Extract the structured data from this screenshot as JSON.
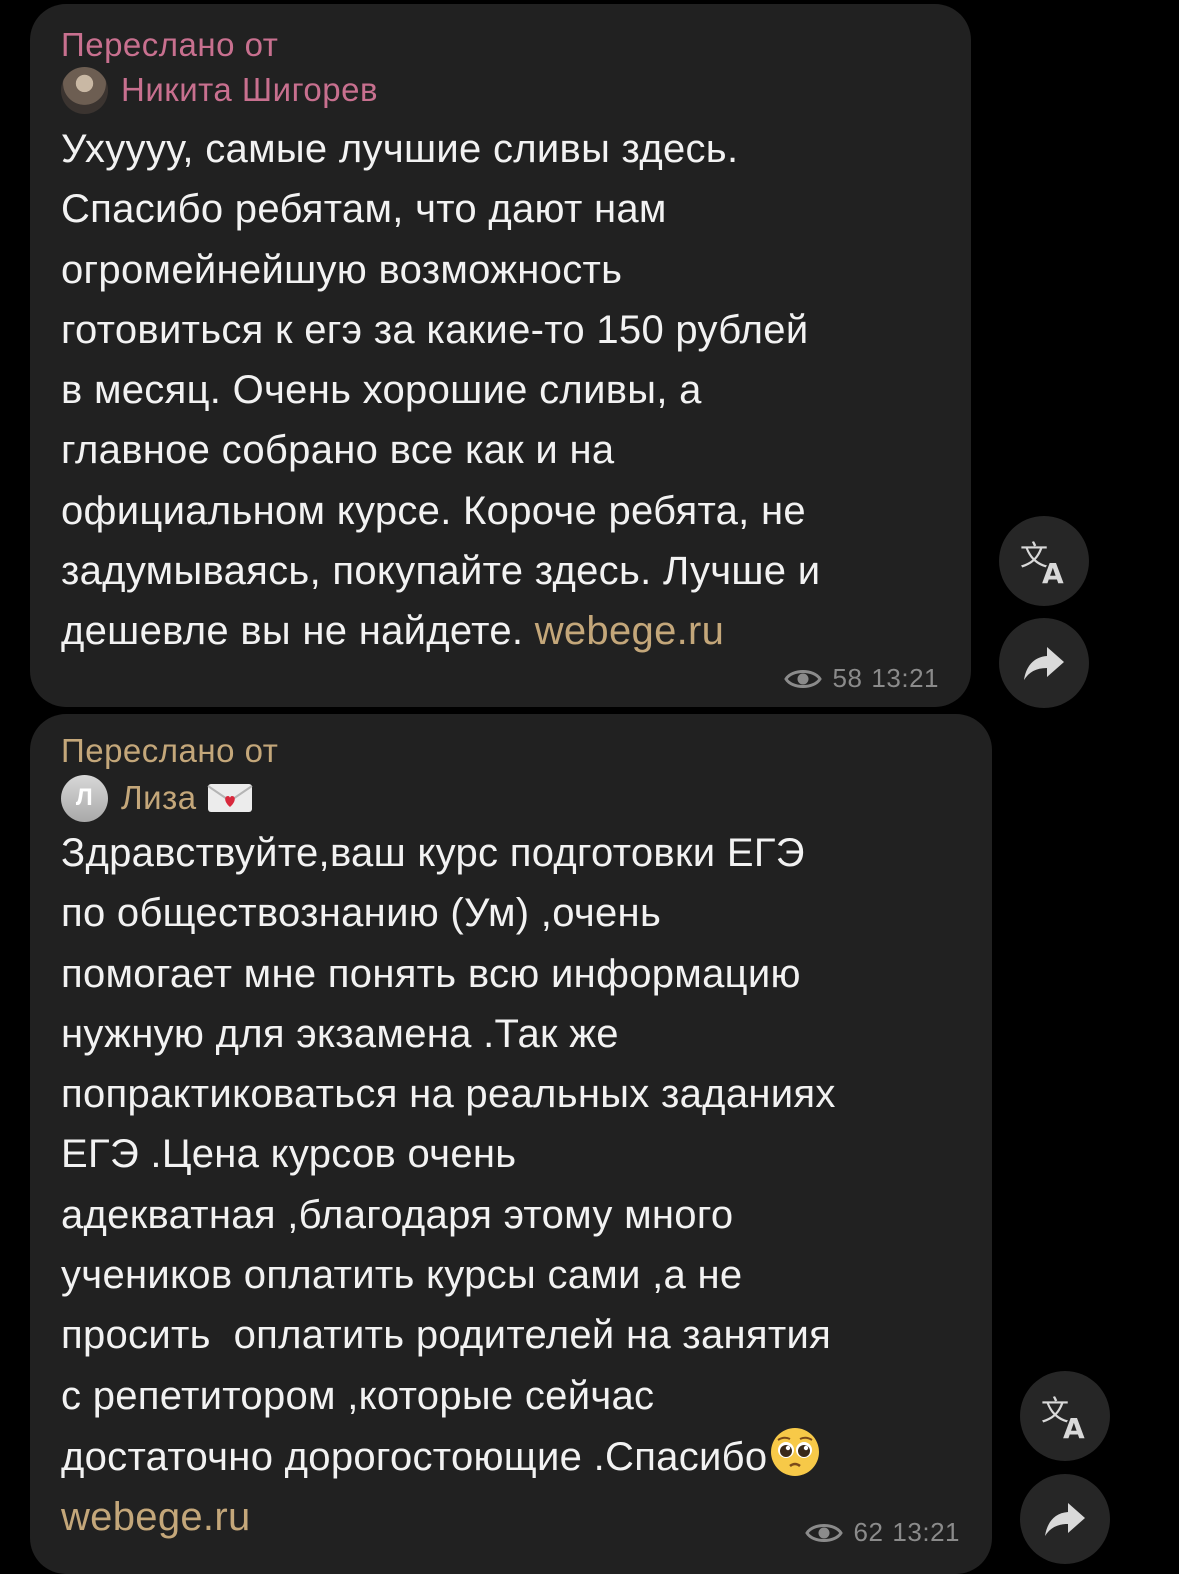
{
  "colors": {
    "background": "#000000",
    "bubble": "#212121",
    "text": "#f2f2f2",
    "link": "#c4a77a",
    "meta": "#8b8b8b",
    "forward_label_1": "#c8708f",
    "forward_label_2": "#c4a77a",
    "side_button": "#262626"
  },
  "messages": [
    {
      "forwarded_label": "Переслано от",
      "author": "Никита Шигорев",
      "avatar_icon": "user-photo-icon",
      "lines": [
        "Ухуууу, самые лучшие сливы здесь.",
        "Спасибо ребятам, что дают нам",
        "огромейнейшую возможность",
        "готовиться к егэ за какие-то 150 рублей",
        "в месяц. Очень хорошие сливы, а",
        "главное собрано все как и на",
        "официальном курсе. Короче ребята, не",
        "задумываясь, покупайте здесь. Лучше и"
      ],
      "last_line_text": "дешевле вы не найдете. ",
      "link": "webege.ru",
      "views": "58",
      "time": "13:21"
    },
    {
      "forwarded_label": "Переслано от",
      "author": "Лиза",
      "avatar_letter": "Л",
      "author_emoji_icon": "love-letter-icon",
      "lines": [
        "Здравствуйте,ваш курс подготовки ЕГЭ",
        "по обществознанию (Ум) ,очень",
        "помогает мне понять всю информацию",
        "нужную для экзамена .Так же",
        "попрактиковаться на реальных заданиях",
        "ЕГЭ .Цена курсов очень",
        "адекватная ,благодаря этому много",
        "учеников оплатить курсы сами ,а не",
        "просить  оплатить родителей на занятия",
        "с репетитором ,которые сейчас"
      ],
      "closing_line_text": "достаточно дорогостоющие .Спасибо",
      "closing_emoji_icon": "pleading-face-icon",
      "link": "webege.ru",
      "views": "62",
      "time": "13:21"
    }
  ],
  "side_buttons": {
    "translate_icon": "translate-icon",
    "share_icon": "share-arrow-icon"
  }
}
